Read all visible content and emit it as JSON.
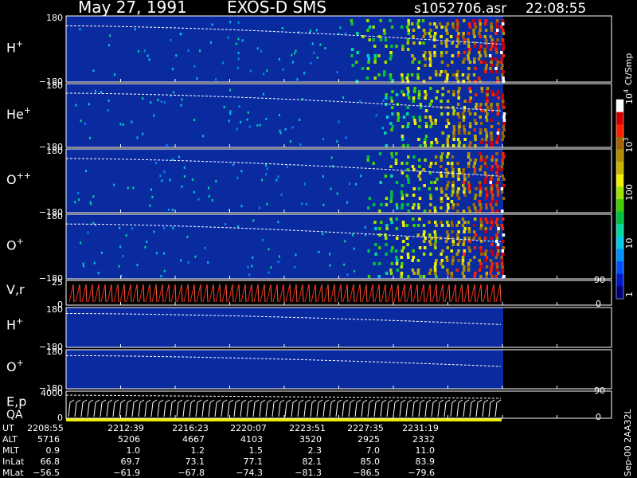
{
  "header": {
    "date": "May 27, 1991",
    "instrument": "EXOS-D SMS",
    "file": "s1052706.asr",
    "time": "22:08:55"
  },
  "side_label": "Sep-00 2AA32L",
  "colorbar": {
    "unit": "Ct/Smp",
    "ticks": [
      {
        "label": "1",
        "value": 1
      },
      {
        "label": "10",
        "value": 10
      },
      {
        "label": "100",
        "value": 100
      },
      {
        "label": "10",
        "exp": "3",
        "value": 1000
      },
      {
        "label": "10",
        "exp": "4",
        "value": 10000
      }
    ],
    "colors": [
      "#00007a",
      "#0018c8",
      "#0050ff",
      "#0090ff",
      "#00c8e8",
      "#00d8a0",
      "#00c040",
      "#40d000",
      "#a0e000",
      "#f0f000",
      "#c8b400",
      "#b08c00",
      "#a06400",
      "#ff2000",
      "#d00000",
      "#ffffff"
    ]
  },
  "chart_data": {
    "type": "heatmap",
    "x_range_ut": [
      "2208:55",
      "2234:30"
    ],
    "panels": [
      {
        "label": "H",
        "sup": "+",
        "ytop": "180",
        "ybot": "−180",
        "y_range": [
          -180,
          180
        ],
        "onset_min": 16.5,
        "bg": "#0a2aa0"
      },
      {
        "label": "He",
        "sup": "+",
        "ytop": "180",
        "ybot": "−180",
        "y_range": [
          -180,
          180
        ],
        "onset_min": 18.5,
        "bg": "#0a2aa0"
      },
      {
        "label": "O",
        "sup": "++",
        "ytop": "180",
        "ybot": "−180",
        "y_range": [
          -180,
          180
        ],
        "onset_min": 17.5,
        "bg": "#0a2aa0"
      },
      {
        "label": "O",
        "sup": "+",
        "ytop": "180",
        "ybot": "−180",
        "y_range": [
          -180,
          180
        ],
        "onset_min": 17.5,
        "bg": "#0a2aa0"
      },
      {
        "label": "V,r",
        "sup": "",
        "ytop": "25",
        "ybot": "0",
        "y_range": [
          0,
          25
        ],
        "right_top": "90",
        "right_bot": "0"
      },
      {
        "label": "H",
        "sup": "+",
        "ytop": "180",
        "ybot": "−180",
        "y_range": [
          -180,
          180
        ],
        "bg": "#0a2aa0"
      },
      {
        "label": "O",
        "sup": "+",
        "ytop": "180",
        "ybot": "−180",
        "y_range": [
          -180,
          180
        ],
        "bg": "#0a2aa0"
      },
      {
        "label": "E,p",
        "label2": "QA",
        "sup": "",
        "ytop": "4000",
        "ybot": "0",
        "y_range": [
          0,
          4000
        ],
        "right_top": "90",
        "right_bot": "0"
      }
    ]
  },
  "table": {
    "rows": [
      {
        "name": "UT",
        "values": [
          "2208:55",
          "2212:39",
          "2216:23",
          "2220:07",
          "2223:51",
          "2227:35",
          "2231:19"
        ]
      },
      {
        "name": "ALT",
        "values": [
          "5716",
          "5206",
          "4667",
          "4103",
          "3520",
          "2925",
          "2332"
        ]
      },
      {
        "name": "MLT",
        "values": [
          "0.9",
          "1.0",
          "1.2",
          "1.5",
          "2.3",
          "7.0",
          "11.0"
        ]
      },
      {
        "name": "InLat",
        "values": [
          "66.8",
          "69.7",
          "73.1",
          "77.1",
          "82.1",
          "85.0",
          "83.9"
        ]
      },
      {
        "name": "MLat",
        "values": [
          "−56.5",
          "−61.9",
          "−67.8",
          "−74.3",
          "−81.3",
          "−86.5",
          "−79.6"
        ]
      }
    ]
  }
}
